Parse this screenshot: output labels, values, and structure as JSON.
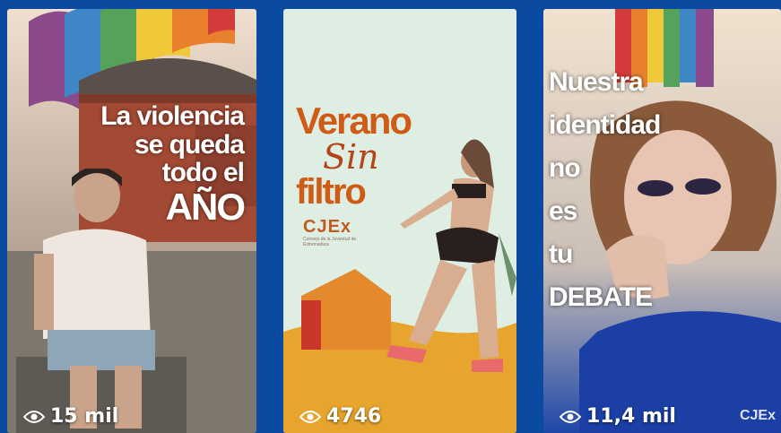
{
  "reels": [
    {
      "overlay_lines": [
        "La violencia",
        "se queda",
        "todo el",
        "AÑO"
      ],
      "views": "15 mil"
    },
    {
      "title_line1": "Verano",
      "title_line2": "Sin",
      "title_line3": "filtro",
      "logo": "CJEx",
      "logo_subtitle": "Consejo de la Juventud de Extremadura",
      "views": "4746"
    },
    {
      "overlay_lines": [
        "Nuestra",
        "identidad",
        "no",
        "es",
        "tu",
        "DEBATE"
      ],
      "watermark": "CJEx",
      "views": "11,4 mil"
    }
  ],
  "icons": {
    "views": "eye-icon"
  },
  "colors": {
    "background": "#0a4aa0",
    "accent_orange": "#d05b17",
    "text": "#ffffff"
  }
}
